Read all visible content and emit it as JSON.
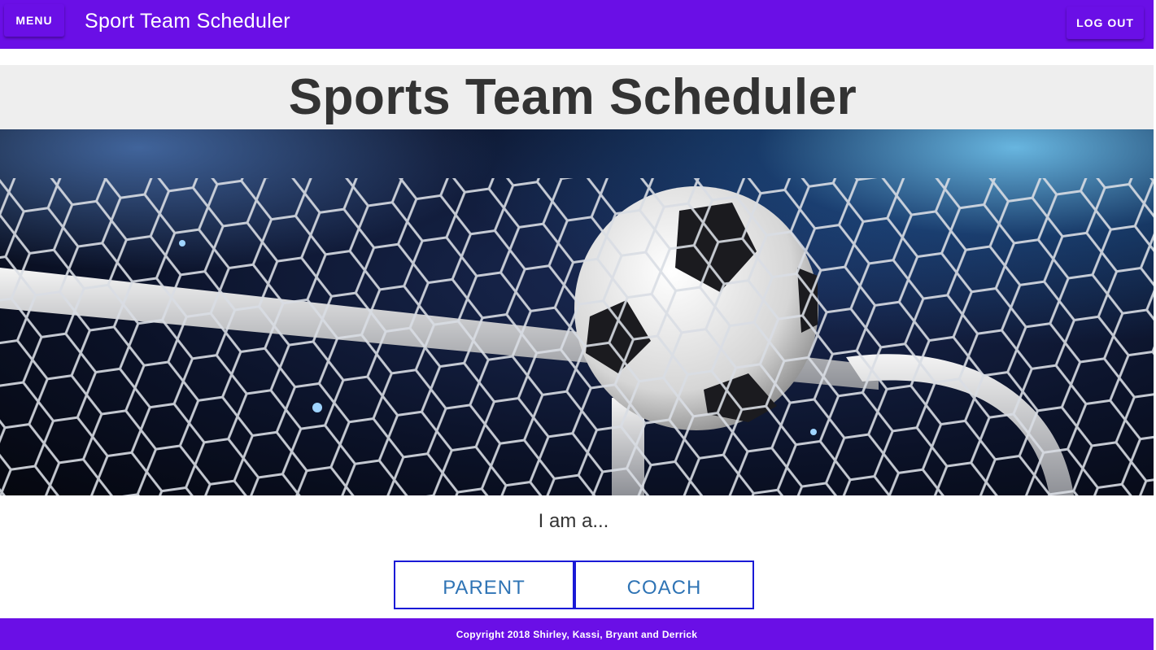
{
  "appbar": {
    "menu_label": "MENU",
    "title": "Sport Team Scheduler",
    "logout_label": "LOG OUT"
  },
  "hero": {
    "title": "Sports Team Scheduler",
    "image": "soccer-ball-in-goal-net"
  },
  "role_picker": {
    "prompt": "I am a...",
    "options": [
      "PARENT",
      "COACH"
    ]
  },
  "footer": {
    "copyright": "Copyright 2018 Shirley, Kassi, Bryant and Derrick"
  },
  "colors": {
    "primary": "#6a0fe6",
    "button_border": "#1a1ad6",
    "button_text": "#2f74b5",
    "title_band": "#eeeeee",
    "title_text": "#333333"
  }
}
